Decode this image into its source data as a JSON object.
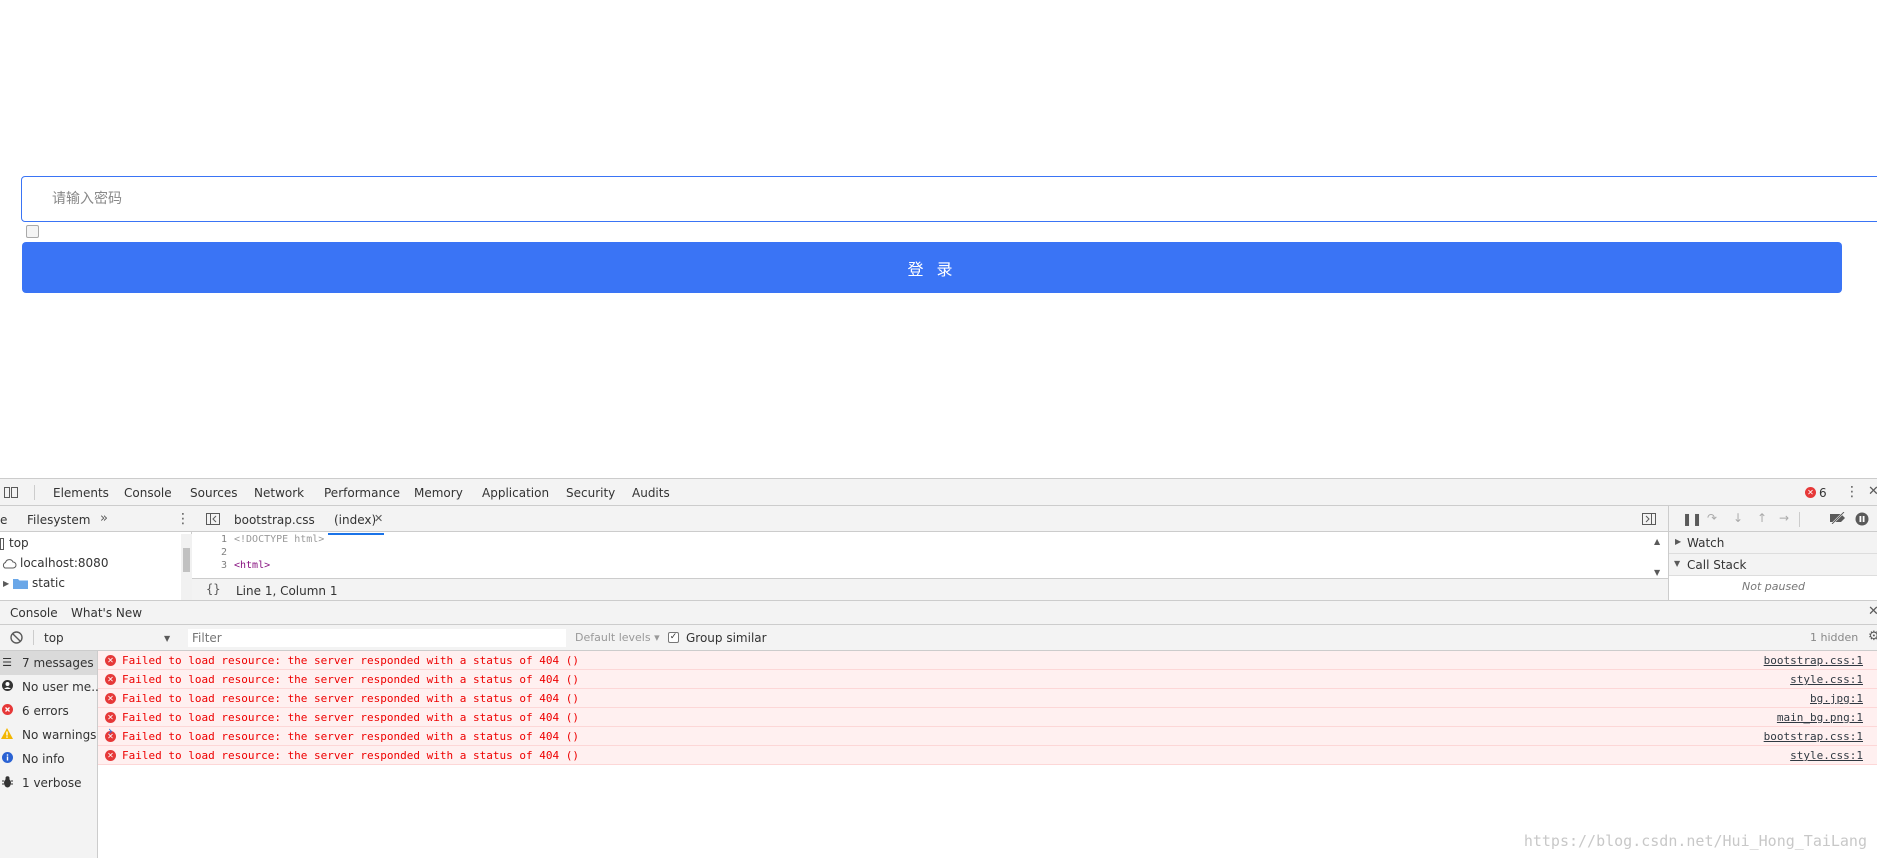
{
  "page": {
    "password_placeholder": "请输入密码",
    "login_button": "登 录"
  },
  "devtools": {
    "tabs": [
      "Elements",
      "Console",
      "Sources",
      "Network",
      "Performance",
      "Memory",
      "Application",
      "Security",
      "Audits"
    ],
    "active_tab": "Sources",
    "error_count": "6",
    "sources": {
      "nav_tabs": [
        "e",
        "Filesystem"
      ],
      "tree": [
        "top",
        "localhost:8080",
        "static"
      ],
      "file_tabs": [
        "bootstrap.css",
        "(index)"
      ],
      "code_lines": [
        {
          "num": "1",
          "text": "<!DOCTYPE html>"
        },
        {
          "num": "2",
          "text": ""
        },
        {
          "num": "3",
          "text": "<html>"
        }
      ],
      "cursor_position": "Line 1, Column 1",
      "watch_label": "Watch",
      "call_stack_label": "Call Stack",
      "not_paused": "Not paused"
    },
    "drawer": {
      "tabs": [
        "Console",
        "What's New"
      ],
      "context": "top",
      "filter_placeholder": "Filter",
      "default_levels": "Default levels ▾",
      "group_similar": "Group similar",
      "hidden_count": "1 hidden",
      "sidebar": [
        {
          "label": "7 messages",
          "icon": "list-icon"
        },
        {
          "label": "No user me...",
          "icon": "user-icon"
        },
        {
          "label": "6 errors",
          "icon": "error-icon"
        },
        {
          "label": "No warnings",
          "icon": "warning-icon"
        },
        {
          "label": "No info",
          "icon": "info-icon"
        },
        {
          "label": "1 verbose",
          "icon": "bug-icon"
        }
      ],
      "messages": [
        {
          "text": "Failed to load resource: the server responded with a status of 404 ()",
          "source": "bootstrap.css:1"
        },
        {
          "text": "Failed to load resource: the server responded with a status of 404 ()",
          "source": "style.css:1"
        },
        {
          "text": "Failed to load resource: the server responded with a status of 404 ()",
          "source": "bg.jpg:1"
        },
        {
          "text": "Failed to load resource: the server responded with a status of 404 ()",
          "source": "main_bg.png:1"
        },
        {
          "text": "Failed to load resource: the server responded with a status of 404 ()",
          "source": "bootstrap.css:1"
        },
        {
          "text": "Failed to load resource: the server responded with a status of 404 ()",
          "source": "style.css:1"
        }
      ]
    }
  },
  "watermark": "https://blog.csdn.net/Hui_Hong_TaiLang",
  "colors": {
    "primary": "#3a74f5",
    "error_red": "#e63838",
    "error_bg": "#fff0f0",
    "devtools_bar": "#f3f3f3"
  }
}
